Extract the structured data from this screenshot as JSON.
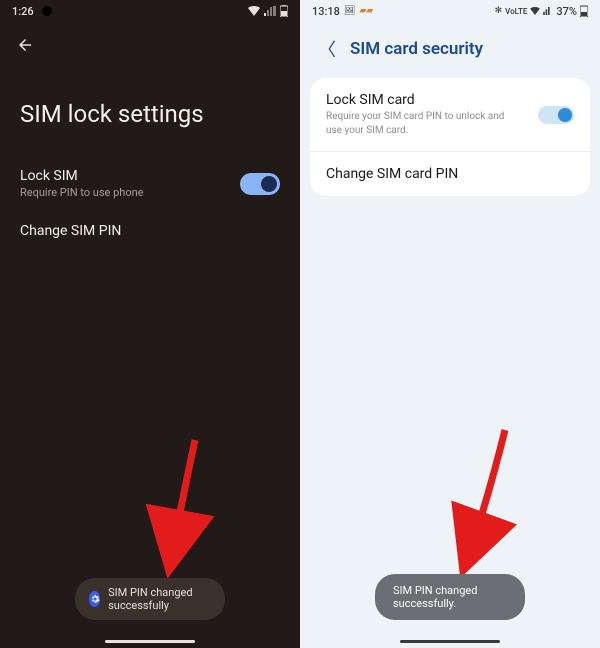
{
  "left": {
    "status": {
      "time": "1:26",
      "icons": "▾ ⚡"
    },
    "title": "SIM lock settings",
    "lock": {
      "title": "Lock SIM",
      "subtitle": "Require PIN to use phone"
    },
    "change": {
      "title": "Change SIM PIN"
    },
    "toast": "SIM PIN changed successfully"
  },
  "right": {
    "status": {
      "time": "13:18",
      "left_icons": "🖼 ⚡⚡",
      "right_icons": "37%"
    },
    "title": "SIM card security",
    "lock": {
      "title": "Lock SIM card",
      "subtitle": "Require your SIM card PIN to unlock and use your SIM card."
    },
    "change": {
      "title": "Change SIM card PIN"
    },
    "toast": "SIM PIN changed successfully."
  }
}
